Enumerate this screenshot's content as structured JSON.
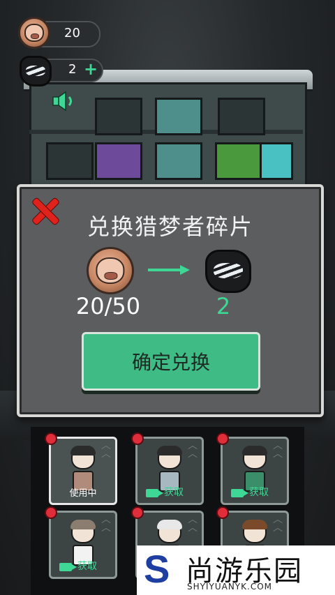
{
  "hud": {
    "coin_count": "20",
    "fragment_count": "2",
    "add_symbol": "+"
  },
  "dialog": {
    "title": "兑换猎梦者碎片",
    "amount_from": "20/50",
    "amount_to": "2",
    "confirm_label": "确定兑换",
    "close_icon": "close-x-icon"
  },
  "characters": [
    {
      "status_label": "使用中",
      "active": true
    },
    {
      "status_label": "获取",
      "active": false
    },
    {
      "status_label": "获取",
      "active": false
    },
    {
      "status_label": "获取",
      "active": false
    },
    {
      "status_label": "",
      "active": false
    },
    {
      "status_label": "",
      "active": false
    }
  ],
  "watermark": {
    "logo_letter": "S",
    "name_cn": "尚游乐园",
    "url": "SHYIYUANYK.COM"
  },
  "colors": {
    "accent_green": "#3ed796",
    "button_green": "#3fbb85",
    "close_red": "#e0221c",
    "badge_red": "#e02d3a"
  }
}
